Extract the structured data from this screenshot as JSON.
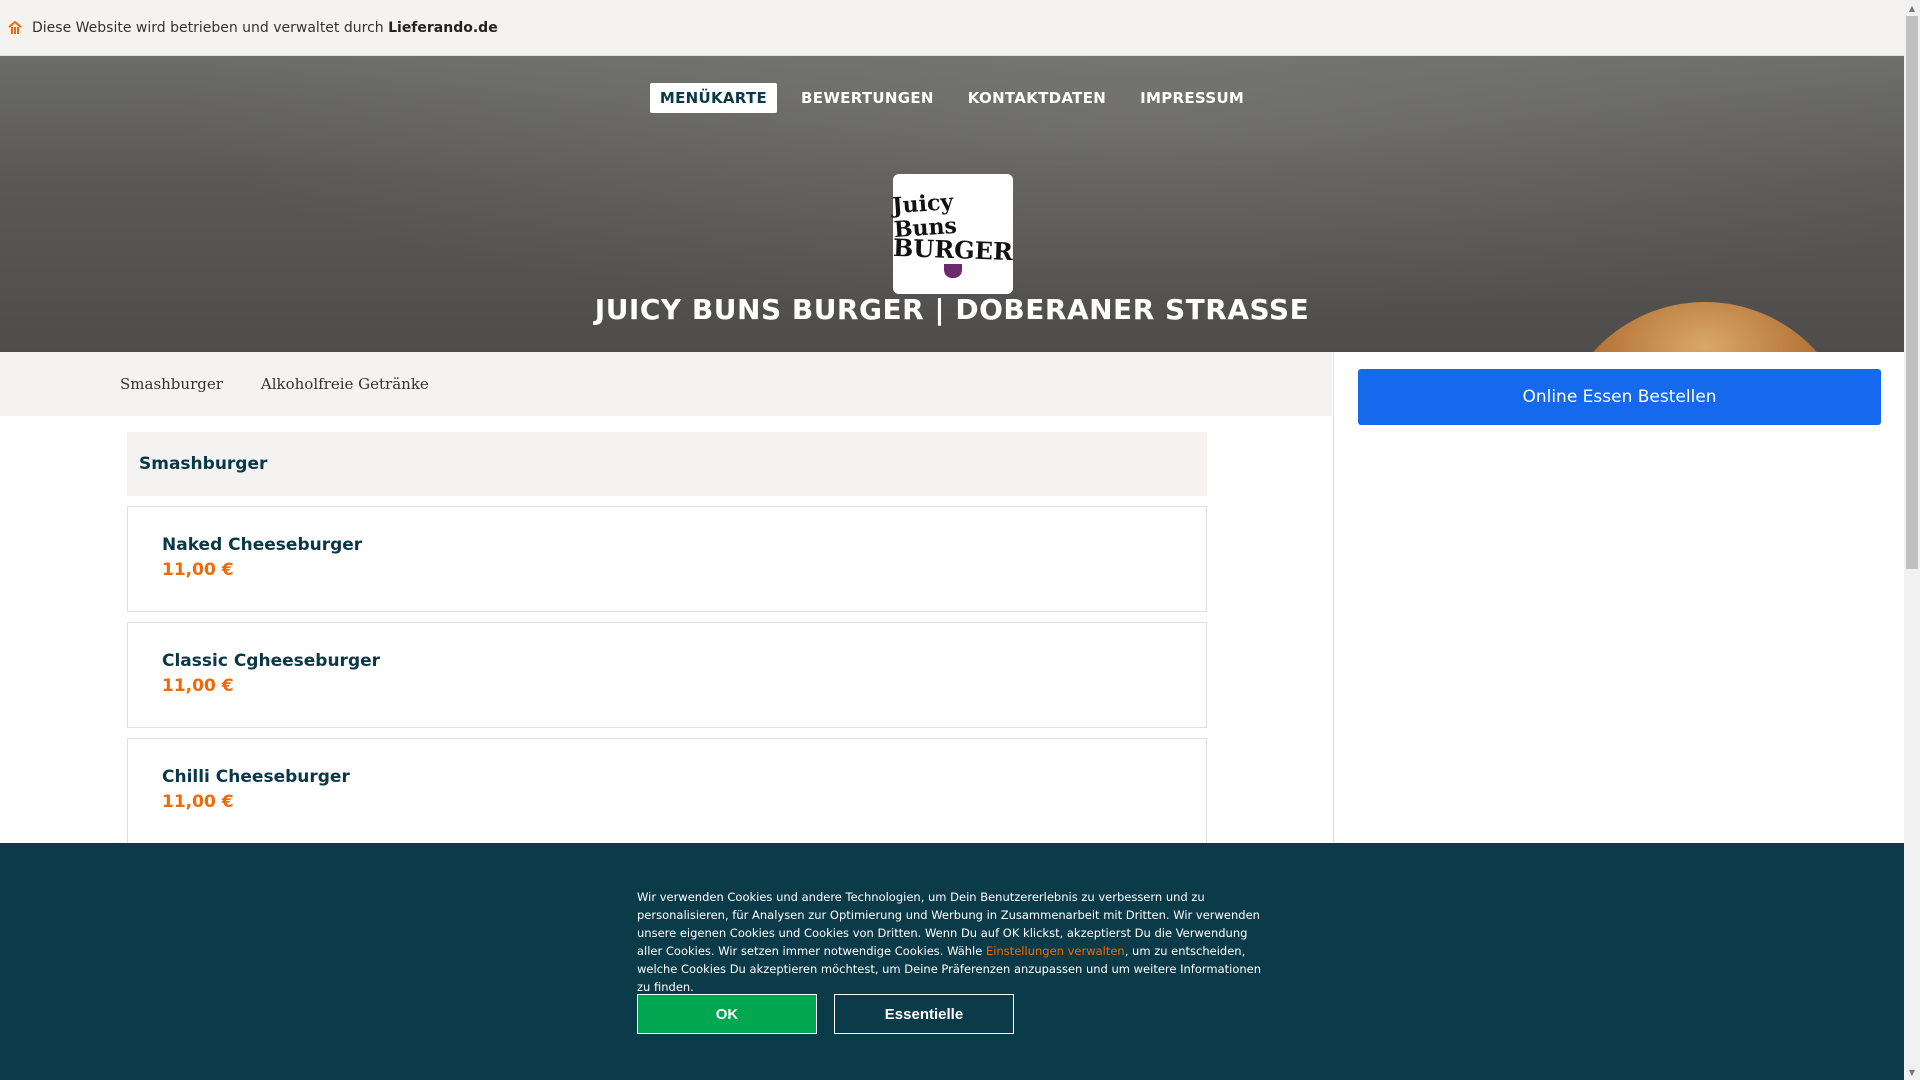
{
  "topbar": {
    "text": "Diese Website wird betrieben und verwaltet durch ",
    "brand": "Lieferando.de",
    "icon": "home-icon"
  },
  "nav": {
    "items": [
      {
        "label": "MENÜKARTE",
        "active": true
      },
      {
        "label": "BEWERTUNGEN",
        "active": false
      },
      {
        "label": "KONTAKTDATEN",
        "active": false
      },
      {
        "label": "IMPRESSUM",
        "active": false
      }
    ]
  },
  "logo": {
    "line1": "Juicy Buns",
    "line2": "BURGER"
  },
  "restaurant": {
    "title": "JUICY BUNS BURGER | DOBERANER STRAßE"
  },
  "categories": [
    "Smashburger",
    "Alkoholfreie Getränke"
  ],
  "order": {
    "button_label": "Online Essen Bestellen"
  },
  "menu": {
    "section_title": "Smashburger",
    "items": [
      {
        "name": "Naked Cheeseburger",
        "price": "11,00 €"
      },
      {
        "name": "Classic Cgheeseburger",
        "price": "11,00 €"
      },
      {
        "name": "Chilli Cheeseburger",
        "price": "11,00 €"
      }
    ]
  },
  "cookie": {
    "text_before": "Wir verwenden Cookies und andere Technologien, um Dein Benutzererlebnis zu verbessern und zu personalisieren, für Analysen zur Optimierung und Werbung in Zusammenarbeit mit Dritten. Wir verwenden unsere eigenen Cookies und Cookies von Dritten. Wenn Du auf OK klickst, akzeptierst Du die Verwendung aller Cookies. Wir setzen immer notwendige Cookies. Wähle ",
    "link": "Einstellungen verwalten",
    "text_after": ", um zu entscheiden, welche Cookies Du akzeptieren möchtest, um Deine Präferenzen anzupassen und um weitere Informationen zu finden.",
    "ok_label": "OK",
    "essential_label": "Essentielle"
  },
  "colors": {
    "accent_orange": "#f36805",
    "primary_blue": "#1569ec",
    "dark_teal": "#0b3a49",
    "ok_green": "#00a650"
  }
}
